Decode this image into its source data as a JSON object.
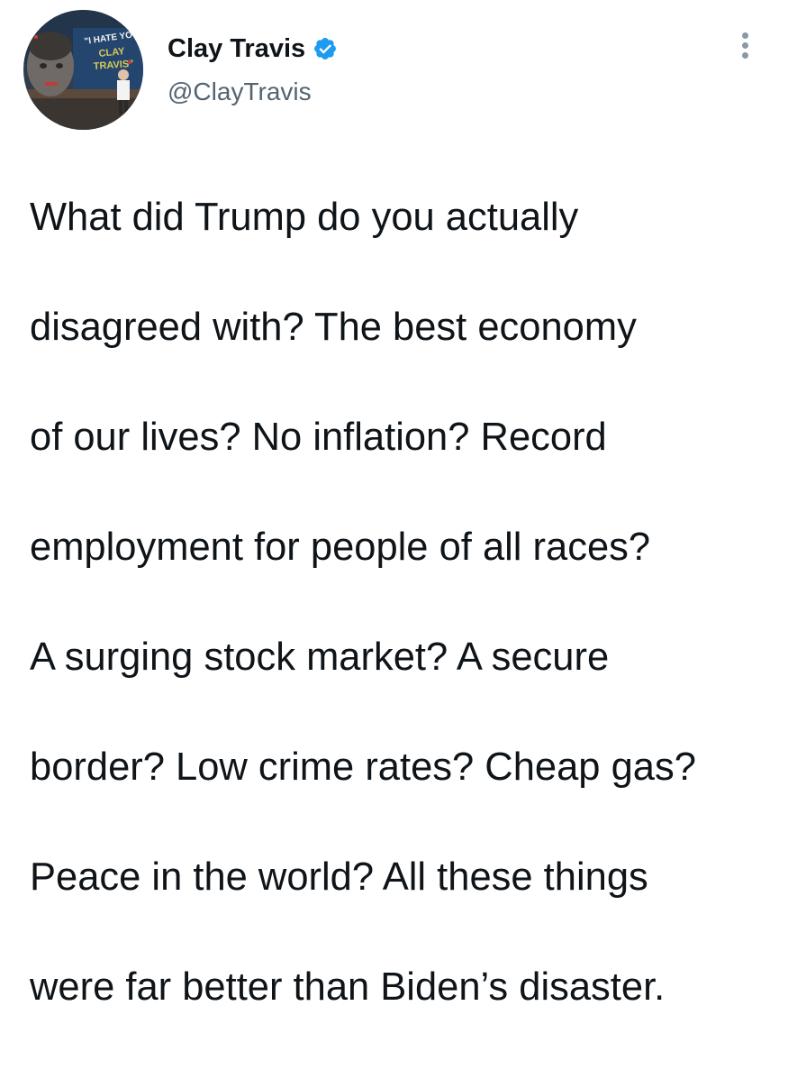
{
  "author": {
    "display_name": "Clay Travis",
    "handle": "@ClayTravis",
    "verified": true,
    "avatar_icon": "profile-photo",
    "avatar_sign_text": "\"I HATE YOU CLAY TRAVIS\""
  },
  "menu": {
    "icon": "more-options-icon"
  },
  "tweet": {
    "text_lines": [
      "What did Trump do you actually",
      "disagreed with? The best economy",
      "of our lives? No inflation? Record",
      "employment for people of all races?",
      "A surging stock market? A secure",
      "border? Low crime rates? Cheap gas?",
      "Peace in the world? All these things",
      "were far better than Biden’s disaster."
    ]
  },
  "colors": {
    "text": "#0f1419",
    "secondary": "#536471",
    "verified_blue": "#1d9bf0",
    "dots": "#8b98a5"
  }
}
